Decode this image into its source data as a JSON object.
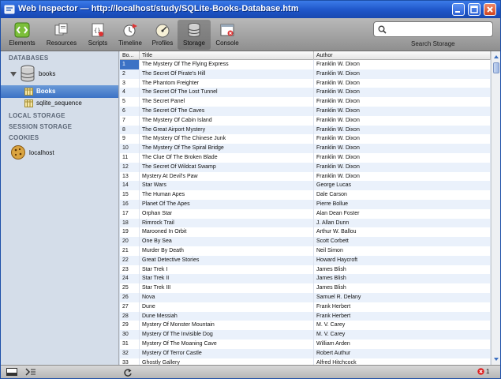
{
  "window": {
    "title": "Web Inspector — http://localhost/study/SQLite-Books-Database.htm"
  },
  "toolbar": {
    "items": [
      {
        "label": "Elements",
        "icon": "elements-icon"
      },
      {
        "label": "Resources",
        "icon": "resources-icon"
      },
      {
        "label": "Scripts",
        "icon": "scripts-icon"
      },
      {
        "label": "Timeline",
        "icon": "timeline-icon"
      },
      {
        "label": "Profiles",
        "icon": "profiles-icon"
      },
      {
        "label": "Storage",
        "icon": "storage-icon",
        "selected": true
      },
      {
        "label": "Console",
        "icon": "console-icon"
      }
    ],
    "search": {
      "value": "",
      "placeholder": "",
      "label": "Search Storage"
    }
  },
  "sidebar": {
    "databases_title": "DATABASES",
    "database_name": "books",
    "tables": [
      "Books",
      "sqlite_sequence"
    ],
    "selected_table": "Books",
    "local_storage_title": "LOCAL STORAGE",
    "session_storage_title": "SESSION STORAGE",
    "cookies_title": "COOKIES",
    "cookie_host": "localhost"
  },
  "grid": {
    "columns": [
      "Bo...",
      "Title",
      "Author"
    ],
    "rows": [
      [
        "1",
        "The Mystery Of The Flying Express",
        "Franklin W. Dixon"
      ],
      [
        "2",
        "The Secret Of Pirate's Hill",
        "Franklin W. Dixon"
      ],
      [
        "3",
        "The Phantom Freighter",
        "Franklin W. Dixon"
      ],
      [
        "4",
        "The Secret Of The Lost Tunnel",
        "Franklin W. Dixon"
      ],
      [
        "5",
        "The Secret Panel",
        "Franklin W. Dixon"
      ],
      [
        "6",
        "The Secret Of The Caves",
        "Franklin W. Dixon"
      ],
      [
        "7",
        "The Mystery Of Cabin Island",
        "Franklin W. Dixon"
      ],
      [
        "8",
        "The Great Airport Mystery",
        "Franklin W. Dixon"
      ],
      [
        "9",
        "The Mystery Of The Chinese Junk",
        "Franklin W. Dixon"
      ],
      [
        "10",
        "The Mystery Of The Spiral Bridge",
        "Franklin W. Dixon"
      ],
      [
        "11",
        "The Clue Of The Broken Blade",
        "Franklin W. Dixon"
      ],
      [
        "12",
        "The Secret Of Wildcat Swamp",
        "Franklin W. Dixon"
      ],
      [
        "13",
        "Mystery At Devil's Paw",
        "Franklin W. Dixon"
      ],
      [
        "14",
        "Star Wars",
        "George Lucas"
      ],
      [
        "15",
        "The Human Apes",
        "Dale Carson"
      ],
      [
        "16",
        "Planet Of The Apes",
        "Pierre Bollue"
      ],
      [
        "17",
        "Orphan Star",
        "Alan Dean Foster"
      ],
      [
        "18",
        "Rimrock Trail",
        "J. Allan Dunn"
      ],
      [
        "19",
        "Marooned In Orbit",
        "Arthur W. Ballou"
      ],
      [
        "20",
        "One By Sea",
        "Scott Corbett"
      ],
      [
        "21",
        "Murder By Death",
        "Neil Simon"
      ],
      [
        "22",
        "Great Detective Stories",
        "Howard Haycroft"
      ],
      [
        "23",
        "Star Trek I",
        "James Blish"
      ],
      [
        "24",
        "Star Trek II",
        "James Blish"
      ],
      [
        "25",
        "Star Trek III",
        "James Blish"
      ],
      [
        "26",
        "Nova",
        "Samuel R. Delany"
      ],
      [
        "27",
        "Dune",
        "Frank Herbert"
      ],
      [
        "28",
        "Dune Messiah",
        "Frank Herbert"
      ],
      [
        "29",
        "Mystery Of Monster Mountain",
        "M. V. Carey"
      ],
      [
        "30",
        "Mystery Of The Invisible Dog",
        "M. V. Carey"
      ],
      [
        "31",
        "Mystery Of The Moaning Cave",
        "William Arden"
      ],
      [
        "32",
        "Mystery Of Terror Castle",
        "Robert Authur"
      ],
      [
        "33",
        "Ghostly Gallery",
        "Alfred Hitchcock"
      ]
    ]
  },
  "statusbar": {
    "error_count": "1"
  },
  "colors": {
    "titlebar": "#1e55c8",
    "selection": "#3c72c5",
    "sidebar_bg": "#d4dde9",
    "row_alt": "#eaf1fb"
  }
}
